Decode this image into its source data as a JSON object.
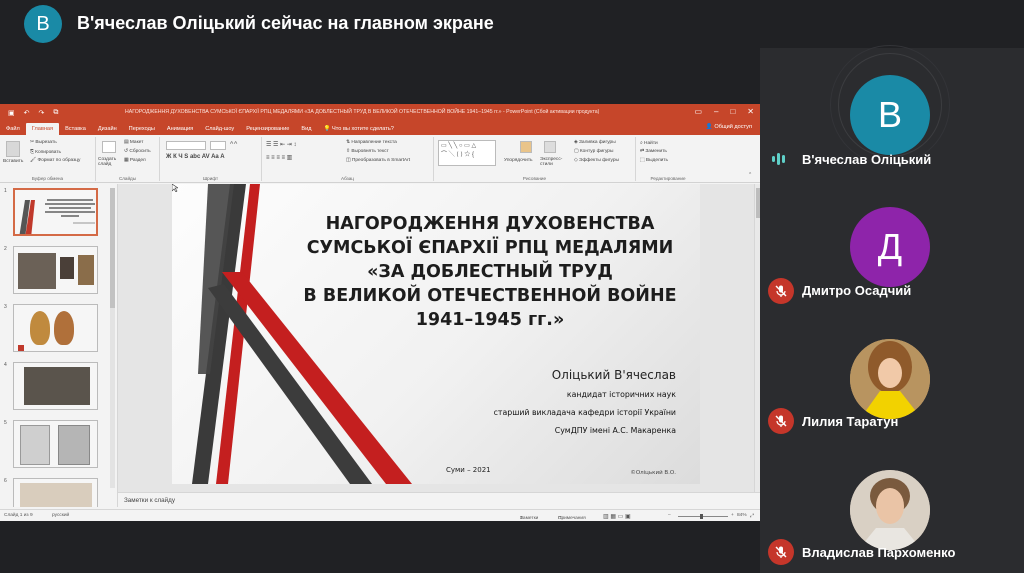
{
  "top_bar": {
    "avatar_letter": "В",
    "title": "В'ячеслав Оліцький сейчас на главном экране"
  },
  "powerpoint": {
    "title_bar": "НАГОРОДЖЕННЯ ДУХОВЕНСТВА СУМСЬКОЇ ЄПАРХІЇ РПЦ МЕДАЛЯМИ «ЗА ДОБЛЕСТНЫЙ ТРУД В ВЕЛИКОЙ ОТЕЧЕСТВЕННОЙ ВОЙНЕ 1941–1945 гг.» - PowerPoint (Сбой активации продукта)",
    "tabs": [
      "Файл",
      "Главная",
      "Вставка",
      "Дизайн",
      "Переходы",
      "Анимация",
      "Слайд-шоу",
      "Рецензирование",
      "Вид"
    ],
    "active_tab": "Главная",
    "tell_me": "Что вы хотите сделать?",
    "share": "Общий доступ",
    "ribbon": {
      "paste": "Вставить",
      "cut": "Вырезать",
      "copy": "Копировать",
      "format_painter": "Формат по образцу",
      "clipboard": "Буфер обмена",
      "new_slide": "Создать слайд",
      "layout": "Макет",
      "reset": "Сбросить",
      "section": "Раздел",
      "slides": "Слайды",
      "font": "Шрифт",
      "paragraph": "Абзац",
      "text_direction": "Направление текста",
      "align_text": "Выровнять текст",
      "smartart": "Преобразовать в SmartArt",
      "arrange": "Упорядочить",
      "quick_styles": "Экспресс-стили",
      "drawing": "Рисование",
      "shape_fill": "Заливка фигуры",
      "shape_outline": "Контур фигуры",
      "shape_effects": "Эффекты фигуры",
      "find": "Найти",
      "replace": "Заменить",
      "select": "Выделить",
      "editing": "Редактирование"
    },
    "thumb_numbers": [
      "1",
      "2",
      "3",
      "4",
      "5",
      "6"
    ],
    "notes_placeholder": "Заметки к слайду",
    "status": {
      "slide_counter": "Слайд 1 из 9",
      "language": "русский",
      "notes": "Заметки",
      "comments": "Примечания",
      "zoom": "84%"
    }
  },
  "slide": {
    "title_lines": [
      "НАГОРОДЖЕННЯ ДУХОВЕНСТВА",
      "СУМСЬКОЇ ЄПАРХІЇ РПЦ МЕДАЛЯМИ",
      "«ЗА ДОБЛЕСТНЫЙ ТРУД",
      "В ВЕЛИКОЙ ОТЕЧЕСТВЕННОЙ ВОЙНЕ",
      "1941–1945 гг.»"
    ],
    "author": "Оліцький В'ячеслав",
    "subtitle_lines": [
      "кандидат історичних наук",
      "старший викладача кафедри історії України",
      "СумДПУ імені А.С. Макаренка"
    ],
    "city": "Суми – 2021",
    "copyright": "©Оліцький В.О."
  },
  "participants": [
    {
      "name": "В'ячеслав Оліцький",
      "initial": "В",
      "color": "#1a8aa6",
      "mic": "speaking"
    },
    {
      "name": "Дмитро Осадчий",
      "initial": "Д",
      "color": "#8e24aa",
      "mic": "muted"
    },
    {
      "name": "Лилия Таратун",
      "initial": "",
      "color": "#c9a46a",
      "mic": "muted"
    },
    {
      "name": "Владислав Пархоменко",
      "initial": "",
      "color": "#b9a89a",
      "mic": "muted"
    }
  ]
}
